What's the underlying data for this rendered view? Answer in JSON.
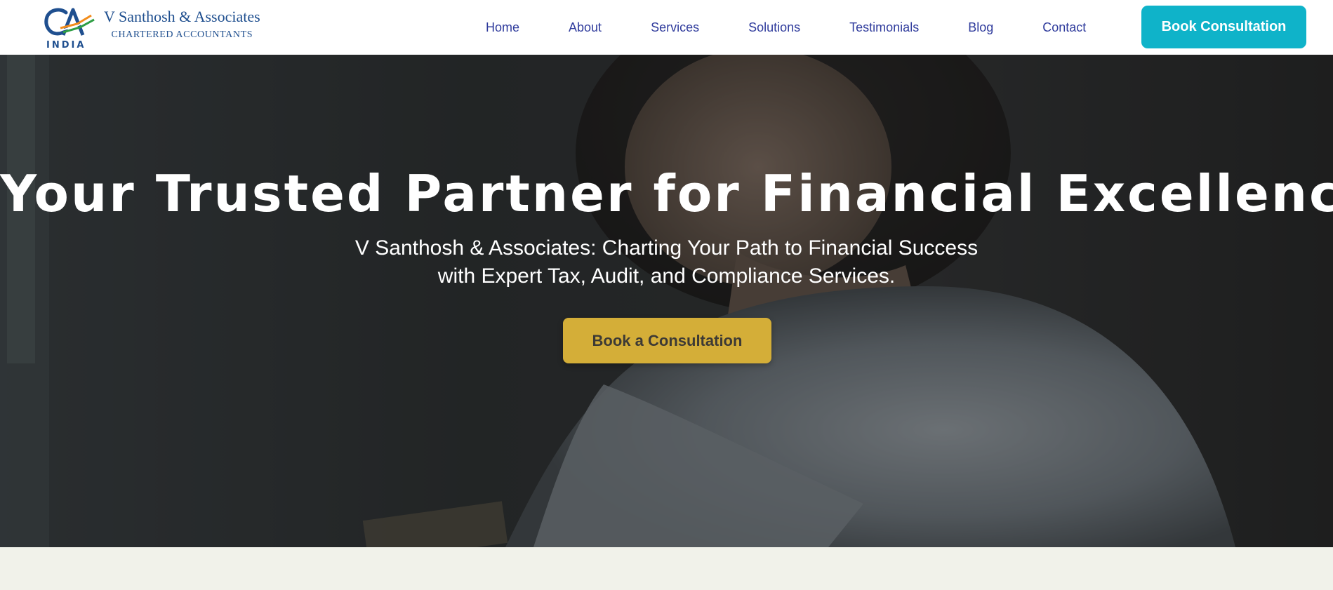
{
  "header": {
    "logo": {
      "mark_text": "CA",
      "country": "INDIA",
      "firm_name": "V Santhosh & Associates",
      "tagline": "CHARTERED ACCOUNTANTS"
    },
    "nav": [
      {
        "label": "Home"
      },
      {
        "label": "About"
      },
      {
        "label": "Services"
      },
      {
        "label": "Solutions"
      },
      {
        "label": "Testimonials"
      },
      {
        "label": "Blog"
      },
      {
        "label": "Contact"
      }
    ],
    "cta_label": "Book Consultation"
  },
  "hero": {
    "title": "Your Trusted Partner for Financial Excellence",
    "subtitle_line1": "V Santhosh & Associates: Charting Your Path to Financial Success",
    "subtitle_line2": "with Expert Tax, Audit, and Compliance Services.",
    "cta_label": "Book a Consultation"
  },
  "colors": {
    "nav_text": "#2f3b9c",
    "header_cta_bg": "#0fb3c9",
    "hero_cta_bg": "#d4ae38",
    "brand_text": "#1f4f8f",
    "section_bg": "#f1f2ea"
  }
}
